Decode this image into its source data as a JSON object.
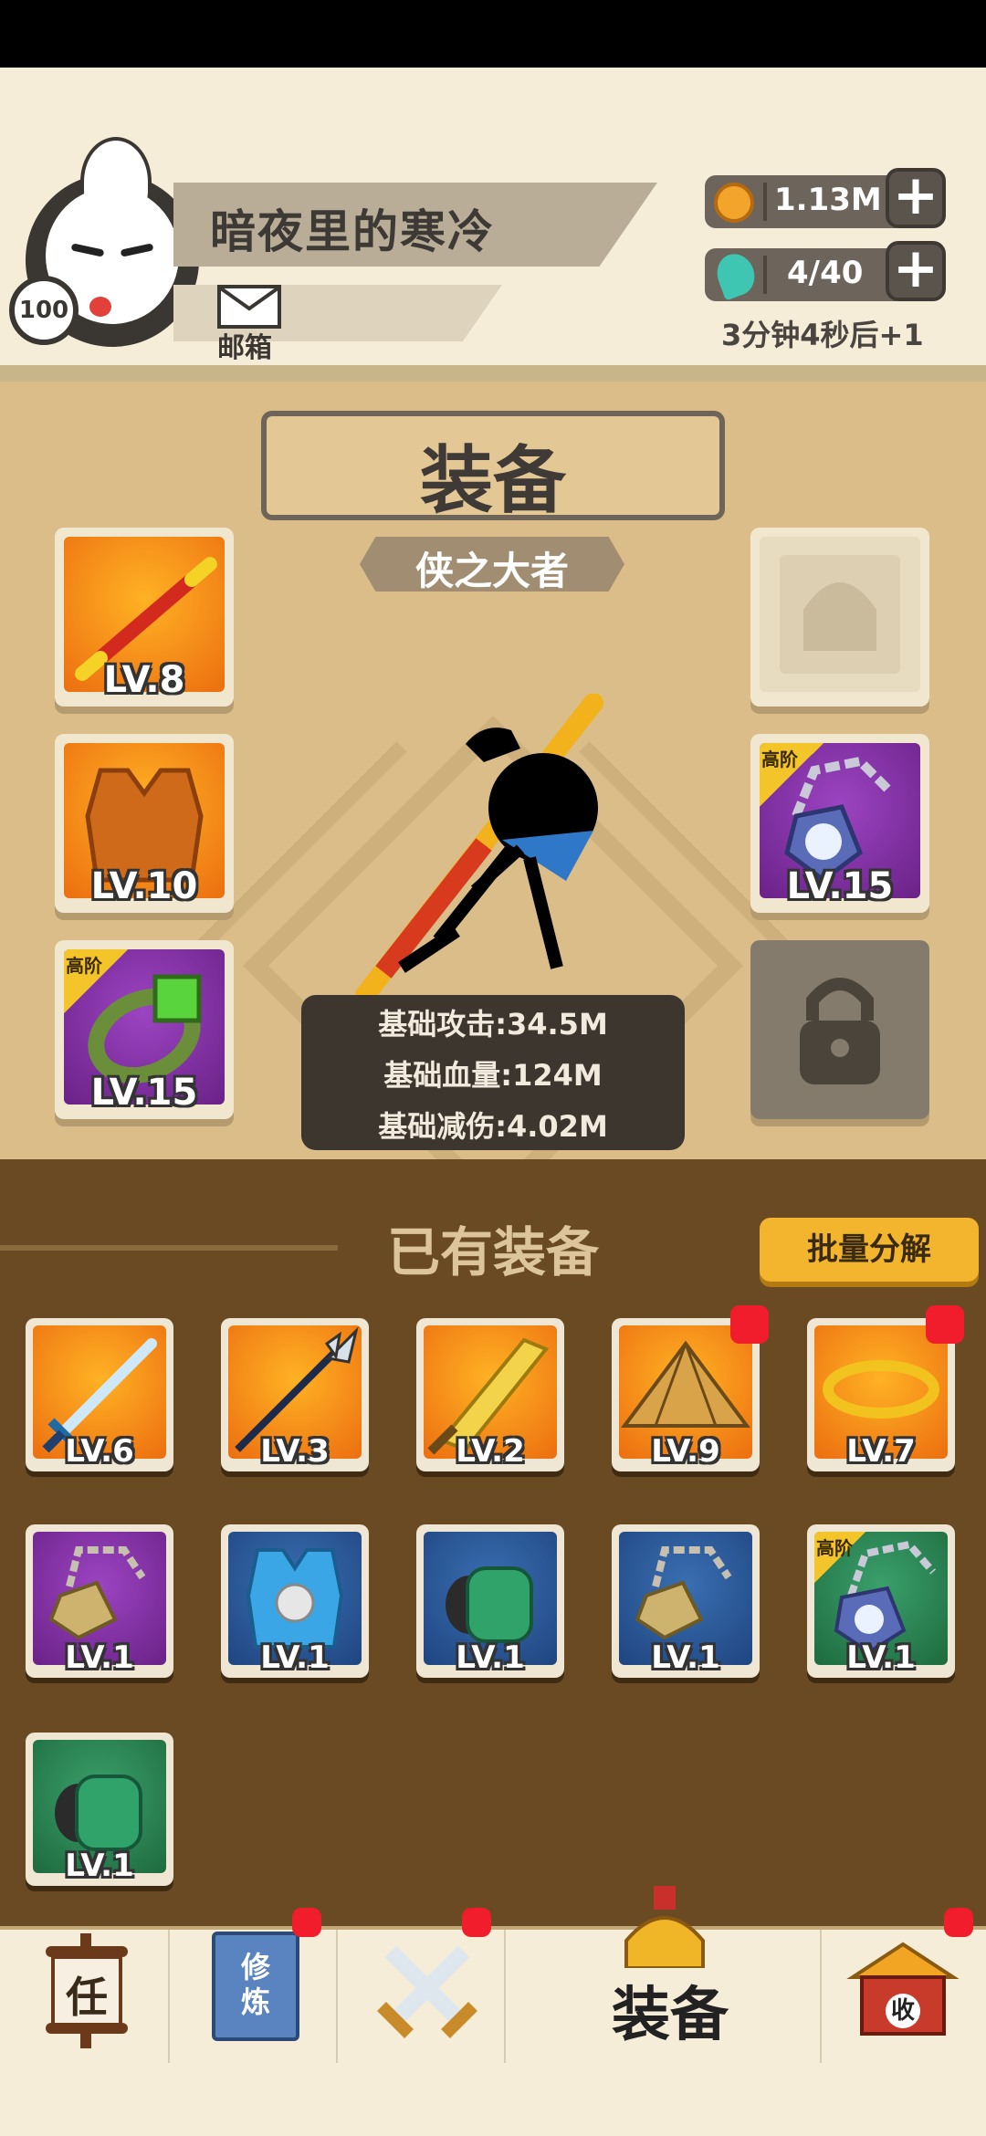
{
  "header": {
    "player_name": "暗夜里的寒冷",
    "level": "100",
    "mail_label": "邮箱",
    "coins": "1.13M",
    "stamina": "4/40",
    "stamina_timer": "3分钟4秒后+1"
  },
  "equipment": {
    "title": "装备",
    "rank_title": "侠之大者",
    "slots_left": [
      {
        "level": "LV.8",
        "item": "staff",
        "rarity": "orange"
      },
      {
        "level": "LV.10",
        "item": "armor-vest",
        "rarity": "orange"
      },
      {
        "level": "LV.15",
        "item": "jade-ring",
        "rarity": "purple",
        "badge": "高阶"
      }
    ],
    "slots_right": [
      {
        "level": "",
        "item": "helmet-empty",
        "rarity": "empty"
      },
      {
        "level": "LV.15",
        "item": "pendant",
        "rarity": "purple",
        "badge": "高阶"
      },
      {
        "level": "",
        "item": "locked",
        "rarity": "locked"
      }
    ],
    "stats": {
      "attack": "基础攻击:34.5M",
      "hp": "基础血量:124M",
      "reduction": "基础减伤:4.02M"
    }
  },
  "owned": {
    "title": "已有装备",
    "batch_button": "批量分解",
    "items": [
      {
        "level": "LV.6",
        "item": "sword",
        "rarity": "orange",
        "new": false
      },
      {
        "level": "LV.3",
        "item": "spear",
        "rarity": "orange",
        "new": false
      },
      {
        "level": "LV.2",
        "item": "broadsword",
        "rarity": "orange",
        "new": false
      },
      {
        "level": "LV.9",
        "item": "straw-hat",
        "rarity": "orange",
        "new": true
      },
      {
        "level": "LV.7",
        "item": "gold-ring",
        "rarity": "orange",
        "new": true
      },
      {
        "level": "LV.1",
        "item": "necklace",
        "rarity": "purple",
        "new": false
      },
      {
        "level": "LV.1",
        "item": "vest",
        "rarity": "blue",
        "new": false
      },
      {
        "level": "LV.1",
        "item": "bracer",
        "rarity": "blue",
        "new": false
      },
      {
        "level": "LV.1",
        "item": "necklace",
        "rarity": "blue",
        "new": false
      },
      {
        "level": "LV.1",
        "item": "pendant",
        "rarity": "green",
        "new": false,
        "badge": "高阶"
      },
      {
        "level": "LV.1",
        "item": "bracer",
        "rarity": "green",
        "new": false
      }
    ]
  },
  "nav": {
    "task_icon_glyph": "任",
    "train_icon_glyph": "修炼",
    "equip_label": "装备",
    "collect_icon_glyph": "收"
  }
}
